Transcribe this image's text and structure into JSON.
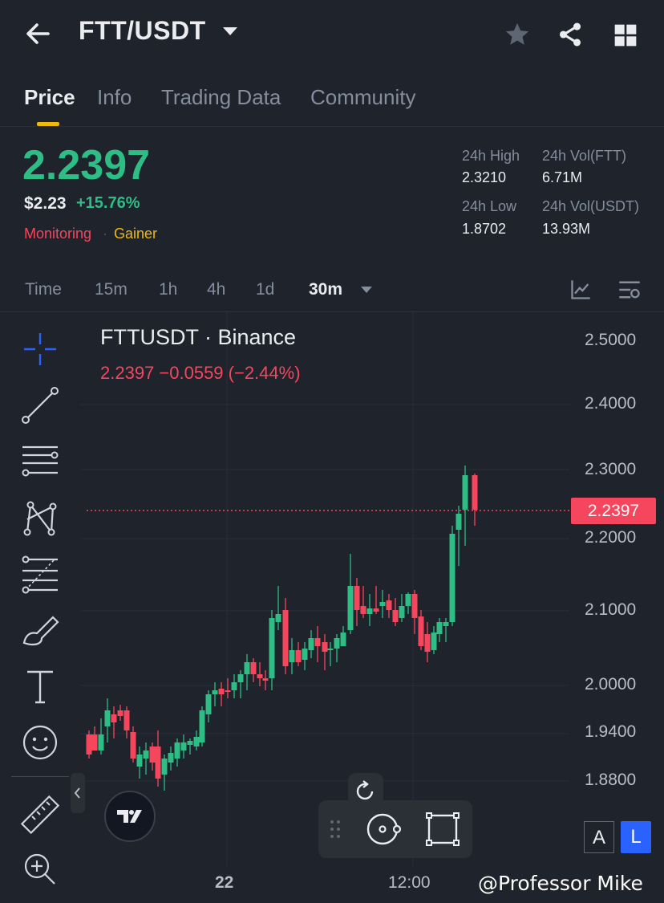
{
  "header": {
    "pair": "FTT/USDT"
  },
  "tabs": [
    "Price",
    "Info",
    "Trading Data",
    "Community"
  ],
  "ticker": {
    "last_price": "2.2397",
    "usd_price": "$2.23",
    "change_pct": "+15.76%",
    "tag_monitoring": "Monitoring",
    "tag_gainer": "Gainer",
    "high_label": "24h High",
    "high_value": "2.3210",
    "low_label": "24h Low",
    "low_value": "1.8702",
    "vol_ftt_label": "24h Vol(FTT)",
    "vol_ftt_value": "6.71M",
    "vol_usdt_label": "24h Vol(USDT)",
    "vol_usdt_value": "13.93M"
  },
  "intervals": [
    "Time",
    "15m",
    "1h",
    "4h",
    "1d",
    "30m"
  ],
  "chart": {
    "symbol_line": "FTTUSDT · Binance",
    "ohlc_line": "2.2397  −0.0559 (−2.44%)",
    "last_price_tag": "2.2397",
    "y_ticks": [
      "2.5000",
      "2.4000",
      "2.3000",
      "2.2000",
      "2.1000",
      "2.0000",
      "1.9400",
      "1.8800"
    ],
    "x_ticks": [
      "22",
      "12:00"
    ],
    "btn_a": "A",
    "btn_l": "L",
    "up_color": "#2ebd85",
    "down_color": "#f6465d"
  },
  "watermark": "@Professor Mike"
}
